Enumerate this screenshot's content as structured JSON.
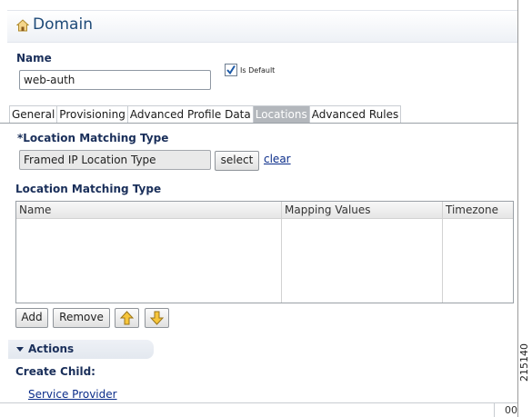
{
  "header": {
    "title": "Domain",
    "icon": "house-icon"
  },
  "name": {
    "label": "Name",
    "value": "web-auth"
  },
  "is_default": {
    "label": "Is Default",
    "checked": true
  },
  "tabs": [
    {
      "label": "General"
    },
    {
      "label": "Provisioning"
    },
    {
      "label": "Advanced Profile Data"
    },
    {
      "label": "Locations",
      "active": true
    },
    {
      "label": "Advanced Rules"
    }
  ],
  "location_matching": {
    "label": "*Location Matching Type",
    "value": "Framed IP Location Type",
    "select_label": "select",
    "clear_label": "clear"
  },
  "location_table": {
    "title": "Location Matching Type",
    "columns": [
      "Name",
      "Mapping Values",
      "Timezone"
    ]
  },
  "table_buttons": {
    "add": "Add",
    "remove": "Remove"
  },
  "actions": {
    "title": "Actions",
    "create_child_label": "Create Child:",
    "service_provider_link": "Service Provider"
  },
  "footer": {
    "text": "00",
    "side_number": "215140"
  },
  "colors": {
    "accent": "#1e4a78",
    "link": "#0b2d8a",
    "active_tab": "#b3b7bc"
  }
}
